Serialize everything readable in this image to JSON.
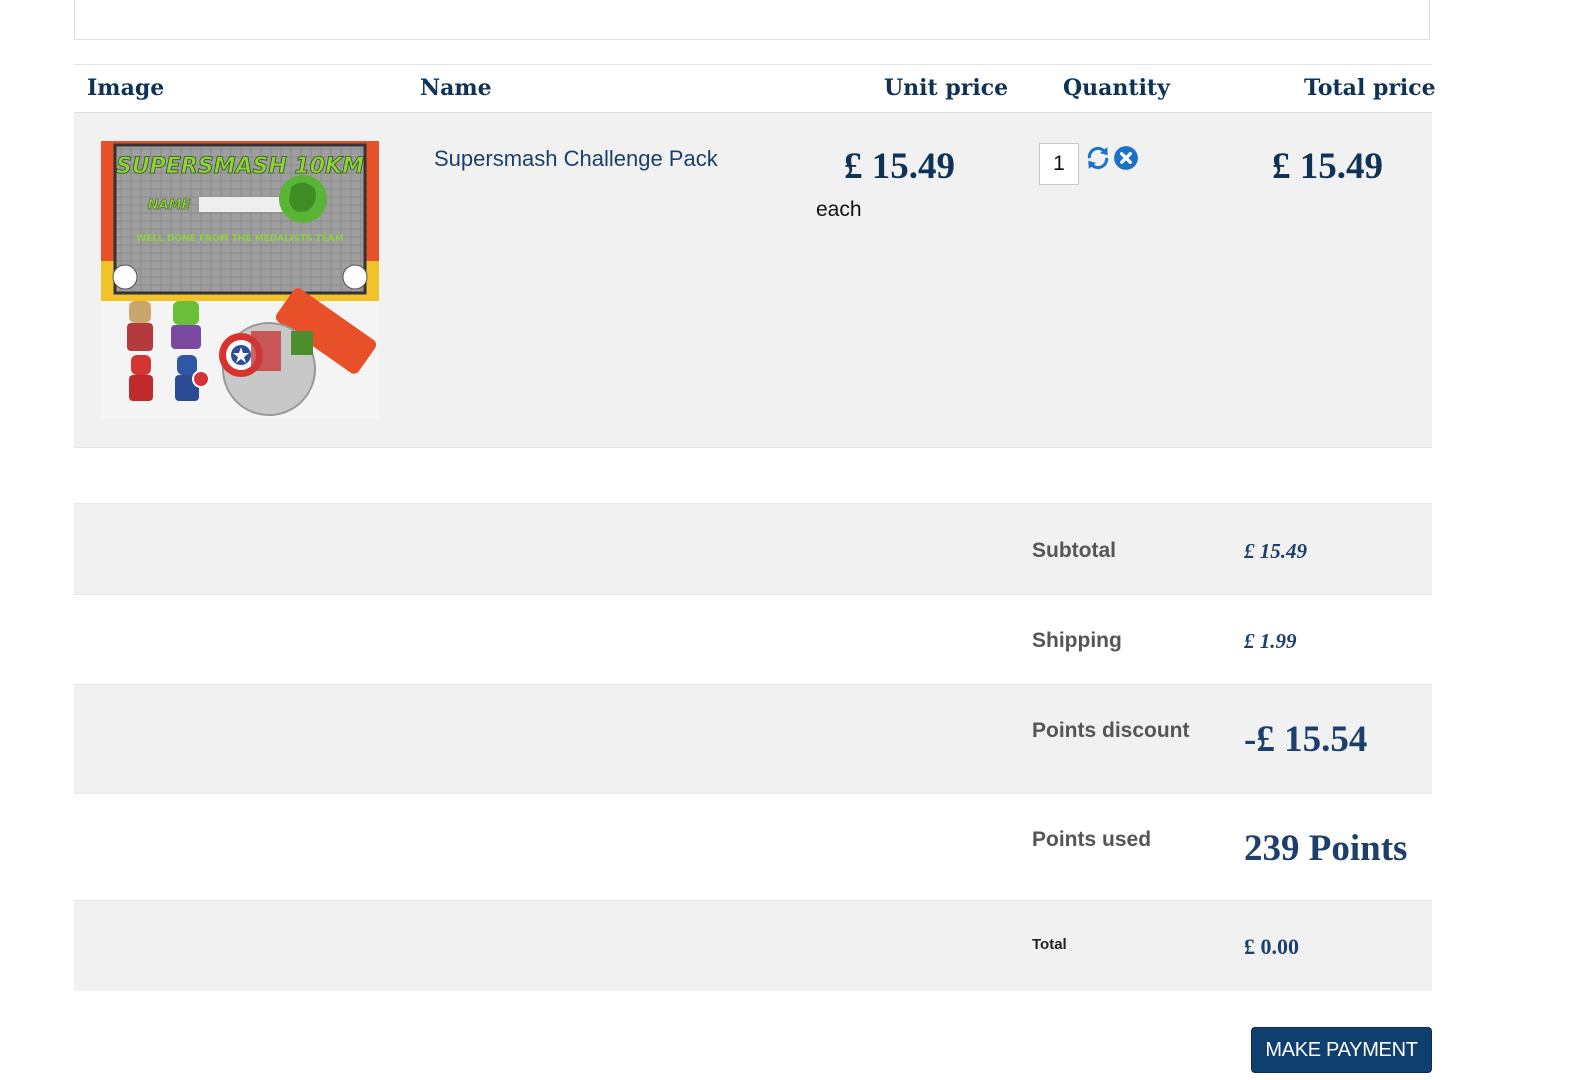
{
  "table": {
    "headers": {
      "image": "Image",
      "name": "Name",
      "unit_price": "Unit price",
      "quantity": "Quantity",
      "total_price": "Total price"
    },
    "items": [
      {
        "name": "Supersmash Challenge Pack",
        "unit_price": "£ 15.49",
        "unit_suffix": "each",
        "quantity": "1",
        "total_price": "£ 15.49",
        "image_text": {
          "title": "SUPERSMASH 10KM",
          "name_label": "NAME",
          "message": "WELL DONE FROM THE MEDALISTS TEAM"
        }
      }
    ]
  },
  "summary": {
    "subtotal_label": "Subtotal",
    "subtotal_value": "£ 15.49",
    "shipping_label": "Shipping",
    "shipping_value": "£ 1.99",
    "points_discount_label": "Points discount",
    "points_discount_value": "-£ 15.54",
    "points_used_label": "Points used",
    "points_used_value": "239 Points",
    "total_label": "Total",
    "total_value": "£ 0.00"
  },
  "actions": {
    "make_payment": "MAKE PAYMENT"
  },
  "colors": {
    "header_text": "#0f3357",
    "link_text": "#1c3f6b",
    "row_background": "#f1f1f1",
    "button_background": "#0f3f6e",
    "icon_blue": "#1a73c9"
  },
  "icons": [
    "refresh-icon",
    "remove-icon"
  ]
}
